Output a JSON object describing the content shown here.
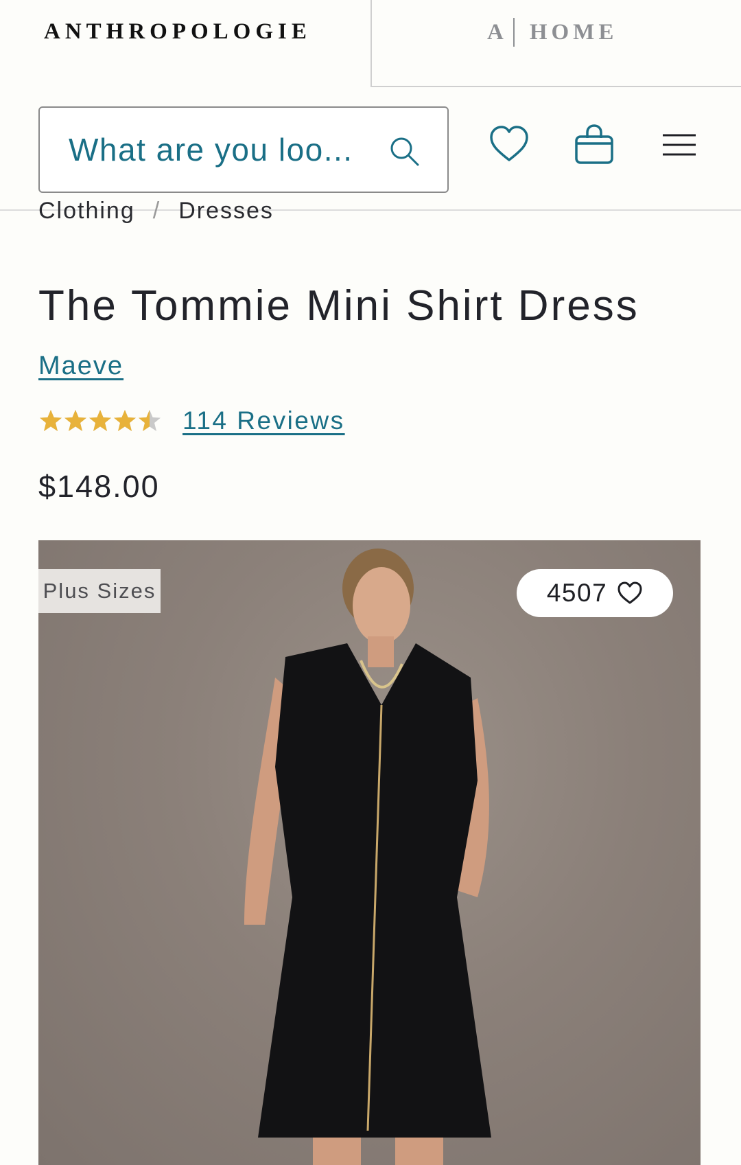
{
  "brand": {
    "logo": "ANTHROPOLOGIE",
    "home_prefix": "A",
    "home_label": "HOME"
  },
  "search": {
    "placeholder": "What are you loo..."
  },
  "icons": {
    "search": "search-icon",
    "wishlist": "heart-icon",
    "bag": "shopping-bag-icon",
    "menu": "hamburger-menu-icon"
  },
  "breadcrumb": {
    "items": [
      "Clothing",
      "Dresses"
    ],
    "separator": "/"
  },
  "product": {
    "title": "The Tommie Mini Shirt Dress",
    "brand": "Maeve",
    "rating": 4.5,
    "rating_max": 5,
    "reviews_label": "114 Reviews",
    "price": "$148.00",
    "badge": "Plus Sizes",
    "favorites_count": "4507"
  },
  "colors": {
    "accent": "#1a6f86",
    "star": "#e8b23a",
    "star_empty": "#c9c9c9",
    "text": "#22232a"
  }
}
